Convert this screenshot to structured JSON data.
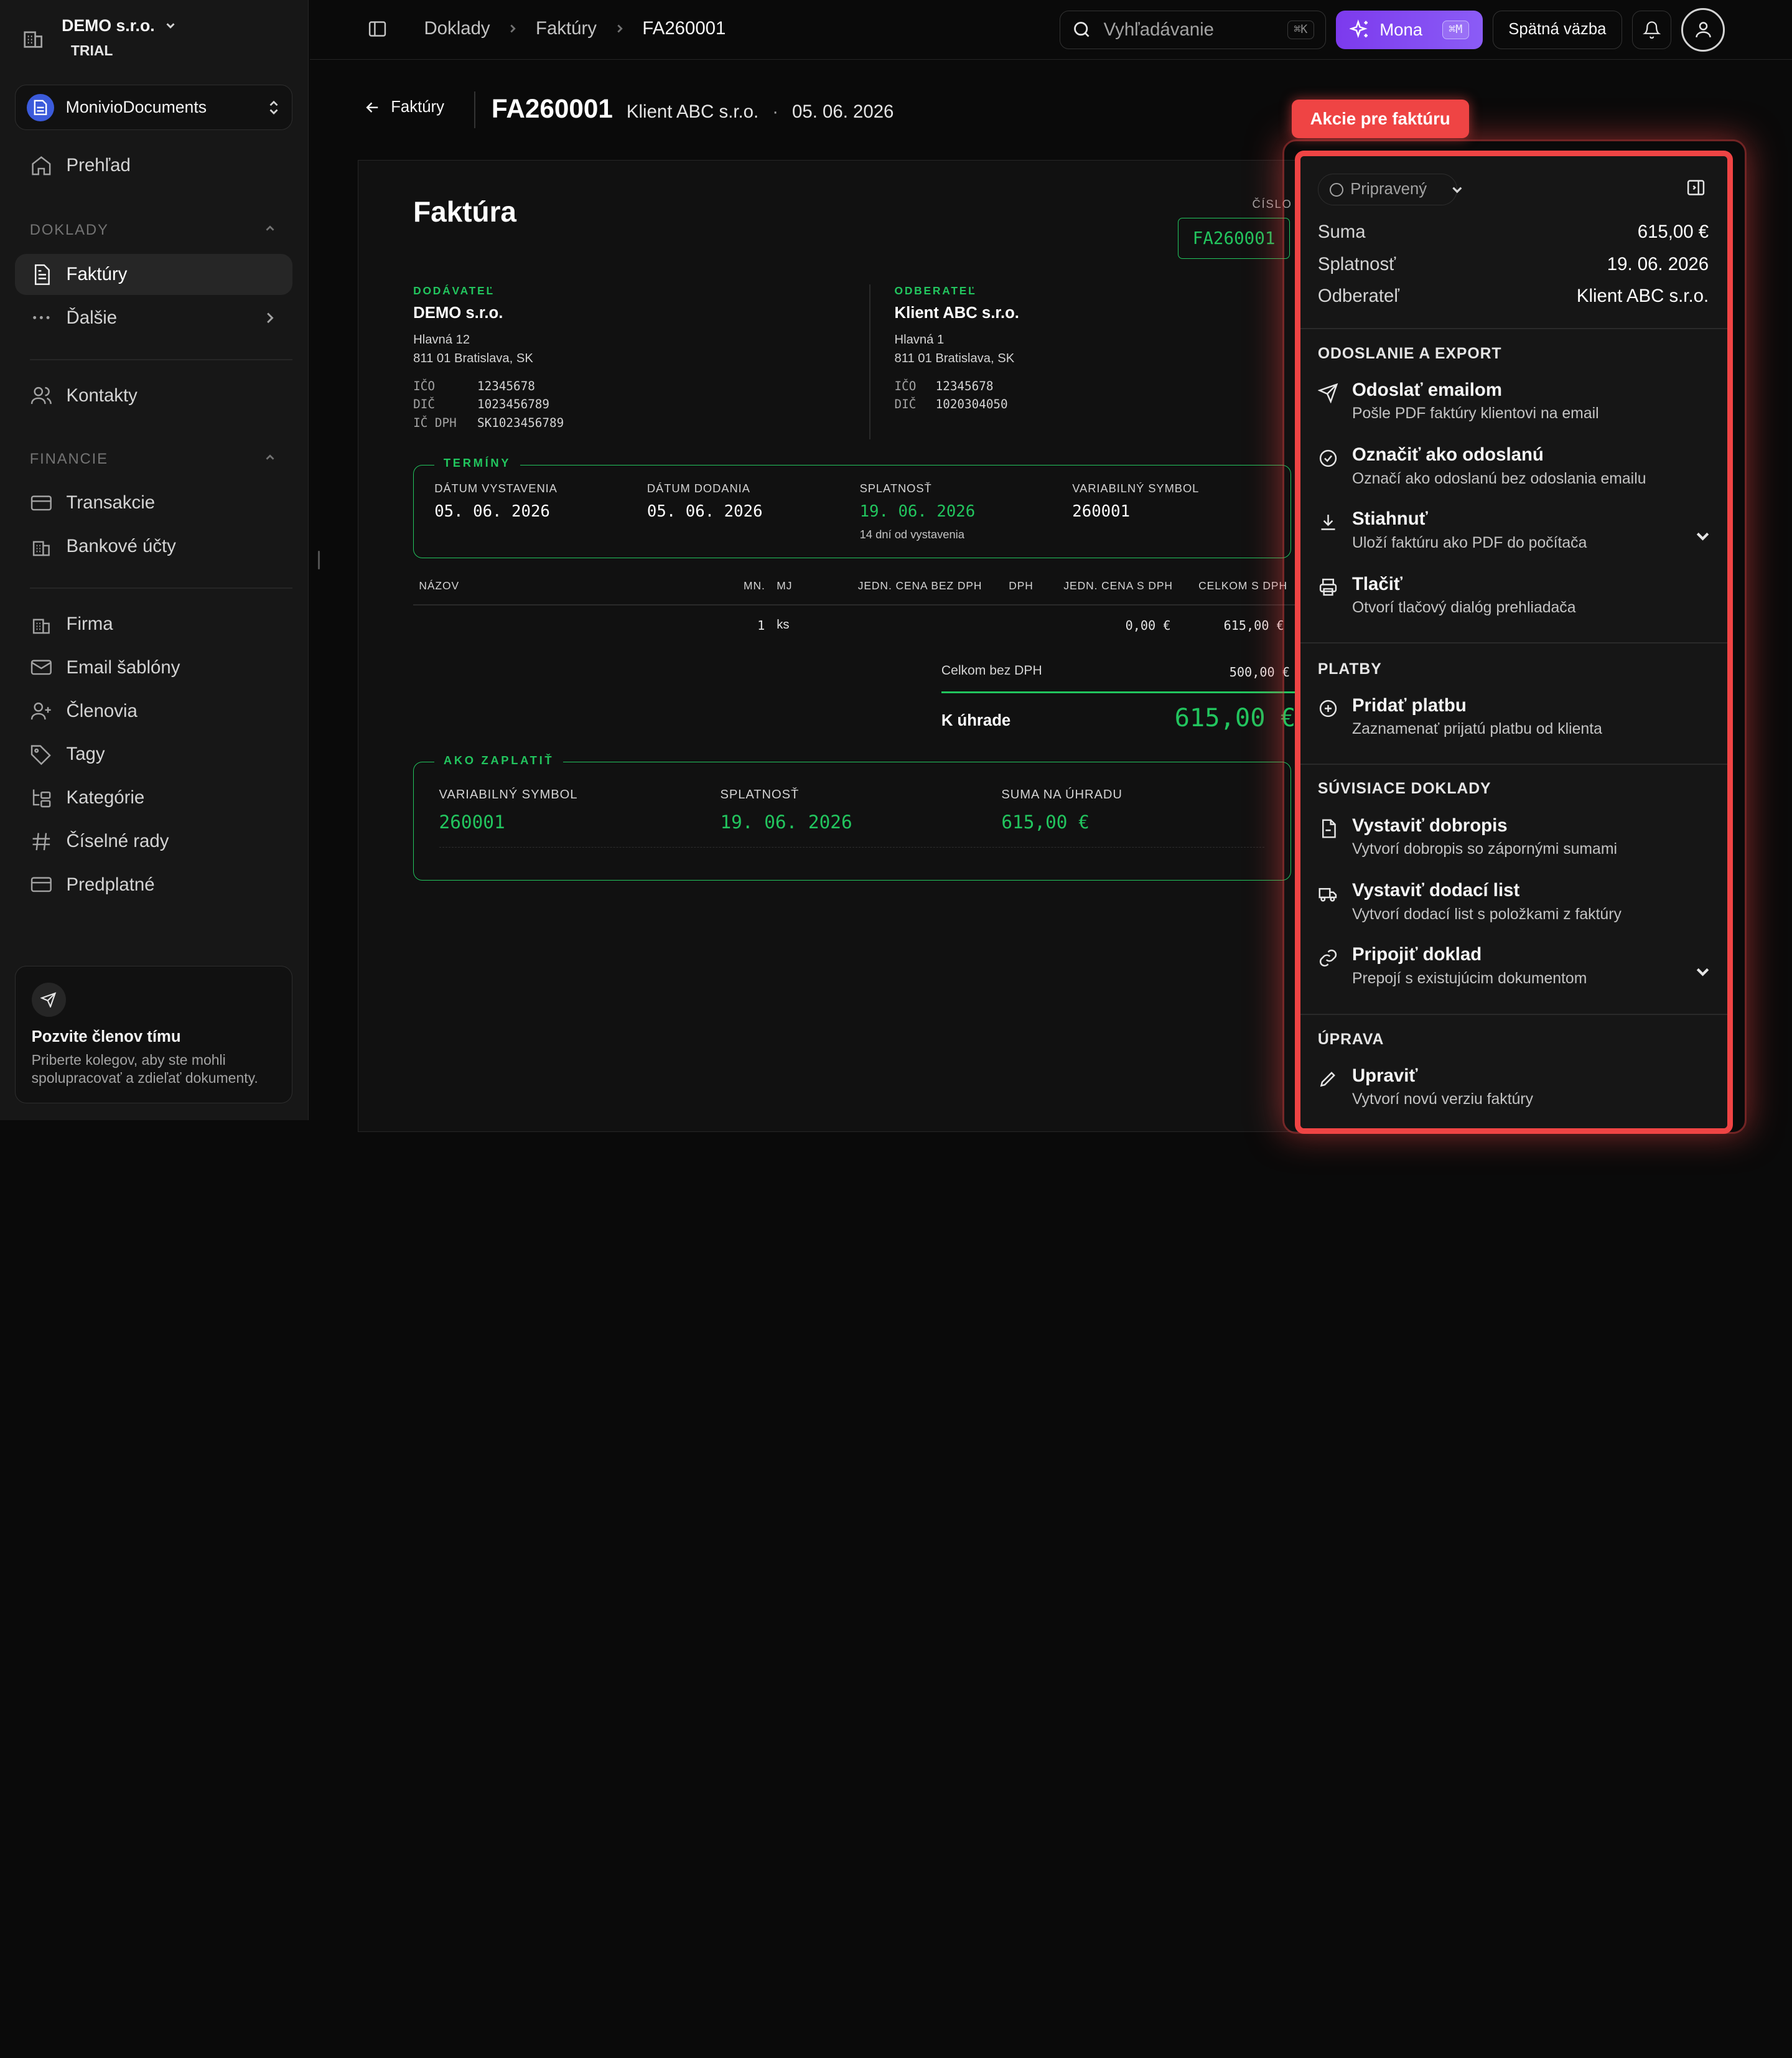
{
  "sidebar": {
    "workspace": {
      "name": "DEMO s.r.o.",
      "plan": "TRIAL"
    },
    "org": {
      "name": "MonivioDocuments"
    },
    "overview": "Prehľad",
    "sections": {
      "doklady": "DOKLADY",
      "financie": "FINANCIE"
    },
    "items": {
      "faktury": "Faktúry",
      "dalsie": "Ďalšie",
      "kontakty": "Kontakty",
      "transakcie": "Transakcie",
      "bankove_ucty": "Bankové účty",
      "firma": "Firma",
      "email_sablony": "Email šablóny",
      "clenovia": "Členovia",
      "tagy": "Tagy",
      "kategorie": "Kategórie",
      "ciselne_rady": "Číselné rady",
      "predplatne": "Predplatné"
    },
    "invite": {
      "title": "Pozvite členov tímu",
      "text": "Priberte kolegov, aby ste mohli spolupracovať a zdieľať dokumenty."
    }
  },
  "topbar": {
    "breadcrumbs": [
      "Doklady",
      "Faktúry",
      "FA260001"
    ],
    "search": {
      "placeholder": "Vyhľadávanie",
      "shortcut": "⌘K"
    },
    "mona": {
      "label": "Mona",
      "shortcut": "⌘M"
    },
    "feedback": "Spätná väzba"
  },
  "header": {
    "back_label": "Faktúry",
    "doc_number": "FA260001",
    "client": "Klient ABC s.r.o.",
    "dot": "·",
    "date": "05. 06. 2026"
  },
  "invoice": {
    "title": "Faktúra",
    "cislo_label": "ČÍSLO",
    "cislo": "FA260001",
    "supplier": {
      "label": "DODÁVATEĽ",
      "name": "DEMO s.r.o.",
      "street": "Hlavná 12",
      "city": "811 01 Bratislava, SK",
      "ico_label": "IČO",
      "ico": "12345678",
      "dic_label": "DIČ",
      "dic": "1023456789",
      "icdph_label": "IČ DPH",
      "icdph": "SK1023456789"
    },
    "customer": {
      "label": "ODBERATEĽ",
      "name": "Klient ABC s.r.o.",
      "street": "Hlavná 1",
      "city": "811 01 Bratislava, SK",
      "ico_label": "IČO",
      "ico": "12345678",
      "dic_label": "DIČ",
      "dic": "1020304050"
    },
    "terms": {
      "label": "TERMÍNY",
      "issue_label": "DÁTUM VYSTAVENIA",
      "issue": "05. 06. 2026",
      "delivery_label": "DÁTUM DODANIA",
      "delivery": "05. 06. 2026",
      "due_label": "SPLATNOSŤ",
      "due": "19. 06. 2026",
      "due_note": "14 dní od vystavenia",
      "vs_label": "VARIABILNÝ SYMBOL",
      "vs": "260001"
    },
    "table": {
      "headers": {
        "name": "NÁZOV",
        "qty": "MN.",
        "unit": "MJ",
        "unit_price": "JEDN. CENA BEZ DPH",
        "vat": "DPH",
        "unit_price_vat": "JEDN. CENA S DPH",
        "total_vat": "CELKOM S DPH"
      },
      "row": {
        "qty": "1",
        "unit": "ks",
        "unit_price_vat": "0,00 €",
        "total_vat": "615,00 €"
      }
    },
    "totals": {
      "net_label": "Celkom bez DPH",
      "net": "500,00 €",
      "due_label": "K úhrade",
      "due": "615,00 €"
    },
    "payment": {
      "label": "AKO ZAPLATIŤ",
      "vs_label": "VARIABILNÝ SYMBOL",
      "vs": "260001",
      "due_label": "SPLATNOSŤ",
      "due": "19. 06. 2026",
      "amount_label": "SUMA NA ÚHRADU",
      "amount": "615,00 €"
    }
  },
  "actions": {
    "tag": "Akcie pre faktúru",
    "status": "Pripravený",
    "summary": {
      "suma_label": "Suma",
      "suma": "615,00 €",
      "splatnost_label": "Splatnosť",
      "splatnost": "19. 06. 2026",
      "odberatel_label": "Odberateľ",
      "odberatel": "Klient ABC s.r.o."
    },
    "sections": {
      "export": "ODOSLANIE A EXPORT",
      "platby": "PLATBY",
      "suvisiace": "SÚVISIACE DOKLADY",
      "uprava": "ÚPRAVA"
    },
    "items": {
      "email": {
        "title": "Odoslať emailom",
        "desc": "Pošle PDF faktúry klientovi na email"
      },
      "mark_sent": {
        "title": "Označiť ako odoslanú",
        "desc": "Označí ako odoslanú bez odoslania emailu"
      },
      "download": {
        "title": "Stiahnuť",
        "desc": "Uloží faktúru ako PDF do počítača"
      },
      "print": {
        "title": "Tlačiť",
        "desc": "Otvorí tlačový dialóg prehliadača"
      },
      "add_payment": {
        "title": "Pridať platbu",
        "desc": "Zaznamenať prijatú platbu od klienta"
      },
      "credit_note": {
        "title": "Vystaviť dobropis",
        "desc": "Vytvorí dobropis so zápornými sumami"
      },
      "delivery_note": {
        "title": "Vystaviť dodací list",
        "desc": "Vytvorí dodací list s položkami z faktúry"
      },
      "attach": {
        "title": "Pripojiť doklad",
        "desc": "Prepojí s existujúcim dokumentom"
      },
      "edit": {
        "title": "Upraviť",
        "desc": "Vytvorí novú verziu faktúry"
      }
    }
  },
  "colors": {
    "accent_green": "#22c55e",
    "highlight_red": "#ef4444",
    "mona_purple": "#8b5cf6"
  }
}
